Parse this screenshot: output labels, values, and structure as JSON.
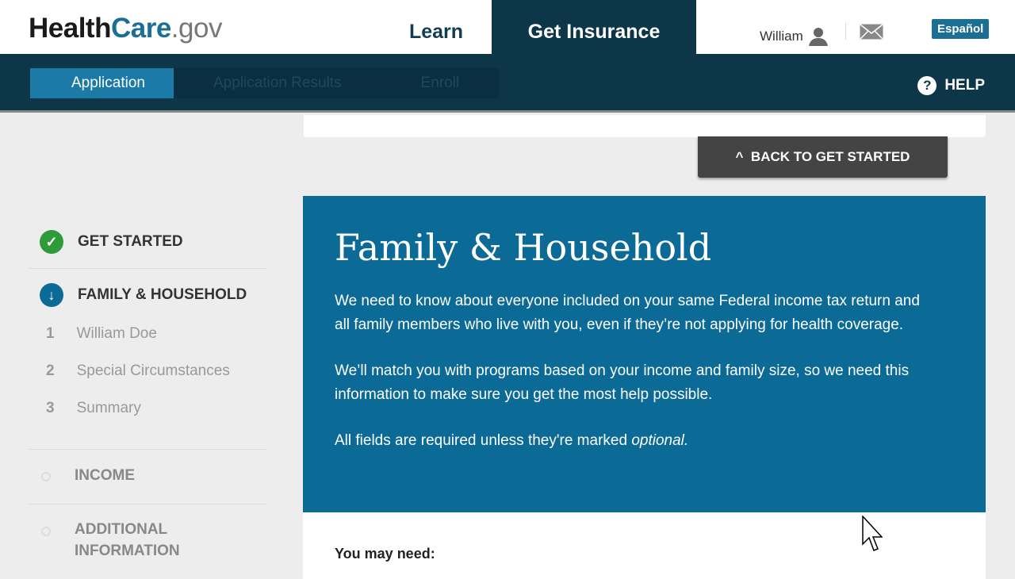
{
  "header": {
    "logo": {
      "part1": "Health",
      "part2": "Care",
      "part3": ".gov"
    },
    "learn": "Learn",
    "get_insurance": "Get Insurance",
    "user": "William",
    "espanol": "Español"
  },
  "nav": {
    "steps": [
      "Application",
      "Application Results",
      "Enroll"
    ],
    "help": "HELP"
  },
  "back_button": "BACK TO GET STARTED",
  "sidebar": {
    "get_started": "GET STARTED",
    "family": "FAMILY & HOUSEHOLD",
    "subitems": [
      {
        "n": "1",
        "label": "William Doe"
      },
      {
        "n": "2",
        "label": "Special Circumstances"
      },
      {
        "n": "3",
        "label": "Summary"
      }
    ],
    "income": "INCOME",
    "additional": "ADDITIONAL INFORMATION"
  },
  "panel": {
    "title": "Family & Household",
    "p1": "We need to know about everyone included on your same Federal income tax return and all family members who live with you, even if they’re not applying for health coverage.",
    "p2": "We’ll match you with programs based on your income and family size, so we need this information to make sure you get the most help possible.",
    "p3_prefix": "All fields are required unless they're marked ",
    "p3_em": "optional."
  },
  "below": {
    "heading": "You may need:"
  },
  "colors": {
    "brand": "#1c6f94",
    "navy": "#0d3649",
    "panel": "#0b6a96",
    "success": "#2e9a3a"
  }
}
